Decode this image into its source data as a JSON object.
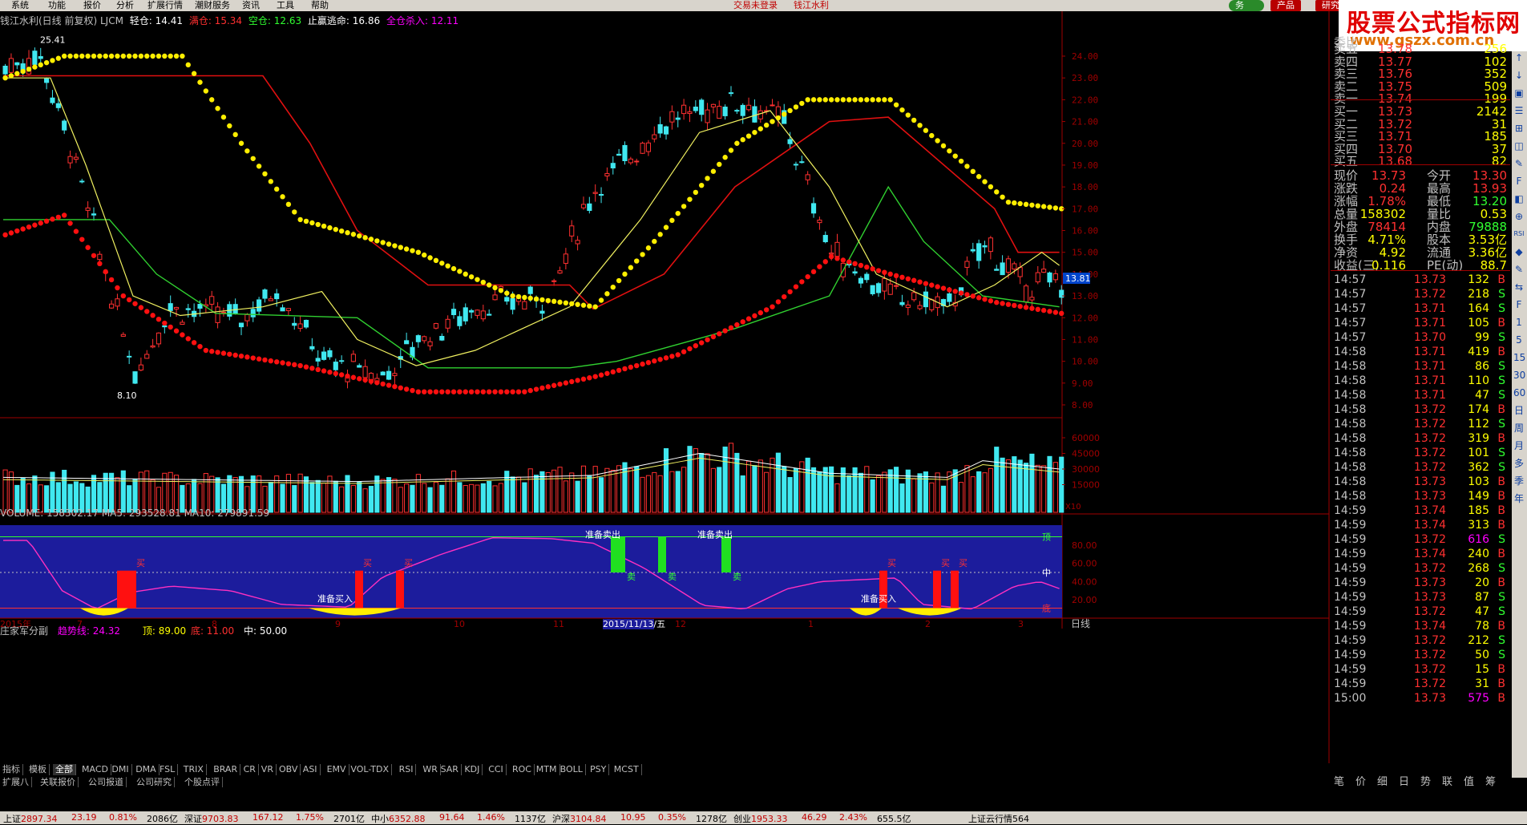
{
  "menu": [
    "系统",
    "功能",
    "报价",
    "分析",
    "扩展行情",
    "潮财服务",
    "资讯",
    "工具",
    "帮助"
  ],
  "menu_center": [
    "交易未登录",
    "钱江水利"
  ],
  "top_buttons": [
    "务",
    "产品",
    "研究"
  ],
  "logo": {
    "line1": "股票公式指标网",
    "line2": "www.gszx.com.cn"
  },
  "main_indicator": {
    "name": "钱江水利(日线 前复权) LJCM",
    "items": [
      {
        "label": "轻仓: 14.41",
        "color": "#ffffff"
      },
      {
        "label": "满仓: 15.34",
        "color": "#ff3030"
      },
      {
        "label": "空仓: 12.63",
        "color": "#30ff30"
      },
      {
        "label": "止赢逃命: 16.86",
        "color": "#ffffff"
      },
      {
        "label": "全仓杀入: 12.11",
        "color": "#ff00ff"
      }
    ],
    "high_label": "25.41",
    "low_label": "8.10",
    "current_price_tag": "13.81",
    "y_ticks": [
      "24.00",
      "23.00",
      "22.00",
      "21.00",
      "20.00",
      "19.00",
      "18.00",
      "17.00",
      "16.00",
      "15.00",
      "14.00",
      "13.00",
      "12.00",
      "11.00",
      "10.00",
      "9.00",
      "8.00"
    ]
  },
  "volume_indicator": {
    "title": "VOLUME: 158302.17  MA5: 293528.81  MA10: 279891.59",
    "y_ticks": [
      "60000",
      "45000",
      "30000",
      "15000"
    ],
    "unit": "X10"
  },
  "sub_indicator": {
    "name": "庄家军分副",
    "trend": "趋势线: 24.32",
    "top": "顶: 89.00",
    "bottom": "底: 11.00",
    "mid": "中: 50.00",
    "y_ticks": [
      "80.00",
      "60.00",
      "40.00",
      "20.00"
    ],
    "labels_right": [
      "顶",
      "中",
      "底"
    ],
    "signal_ready_sell": "准备卖出",
    "signal_ready_buy": "准备买入",
    "signal_buy": "买",
    "signal_sell": "卖"
  },
  "x_axis": {
    "labels": [
      "2015年",
      "7",
      "8",
      "9",
      "10",
      "11",
      "2015/11/13/五",
      "12",
      "1",
      "2",
      "3"
    ],
    "period": "日线"
  },
  "quote": {
    "header": "委比",
    "sell": [
      {
        "label": "卖五",
        "price": "13.78",
        "vol": "256"
      },
      {
        "label": "卖四",
        "price": "13.77",
        "vol": "102"
      },
      {
        "label": "卖三",
        "price": "13.76",
        "vol": "352"
      },
      {
        "label": "卖二",
        "price": "13.75",
        "vol": "509"
      },
      {
        "label": "卖一",
        "price": "13.74",
        "vol": "199"
      }
    ],
    "buy": [
      {
        "label": "买一",
        "price": "13.73",
        "vol": "2142"
      },
      {
        "label": "买二",
        "price": "13.72",
        "vol": "31"
      },
      {
        "label": "买三",
        "price": "13.71",
        "vol": "185"
      },
      {
        "label": "买四",
        "price": "13.70",
        "vol": "37"
      },
      {
        "label": "买五",
        "price": "13.68",
        "vol": "82"
      }
    ],
    "stats": [
      {
        "l1": "现价",
        "v1": "13.73",
        "c1": "#ff3030",
        "l2": "今开",
        "v2": "13.30",
        "c2": "#ff3030"
      },
      {
        "l1": "涨跌",
        "v1": "0.24",
        "c1": "#ff3030",
        "l2": "最高",
        "v2": "13.93",
        "c2": "#ff3030"
      },
      {
        "l1": "涨幅",
        "v1": "1.78%",
        "c1": "#ff3030",
        "l2": "最低",
        "v2": "13.20",
        "c2": "#30ff30"
      },
      {
        "l1": "总量",
        "v1": "158302",
        "c1": "#ffff00",
        "l2": "量比",
        "v2": "0.53",
        "c2": "#ffff00"
      },
      {
        "l1": "外盘",
        "v1": "78414",
        "c1": "#ff3030",
        "l2": "内盘",
        "v2": "79888",
        "c2": "#30ff30"
      },
      {
        "l1": "换手",
        "v1": "4.71%",
        "c1": "#ffff00",
        "l2": "股本",
        "v2": "3.53亿",
        "c2": "#ffff00"
      },
      {
        "l1": "净资",
        "v1": "4.92",
        "c1": "#ffff00",
        "l2": "流通",
        "v2": "3.36亿",
        "c2": "#ffff00"
      },
      {
        "l1": "收益(三)",
        "v1": "0.116",
        "c1": "#ffff00",
        "l2": "PE(动)",
        "v2": "88.7",
        "c2": "#ffff00"
      }
    ],
    "ticks": [
      [
        "14:57",
        "13.73",
        "132",
        "B"
      ],
      [
        "14:57",
        "13.72",
        "218",
        "S"
      ],
      [
        "14:57",
        "13.71",
        "164",
        "S"
      ],
      [
        "14:57",
        "13.71",
        "105",
        "B"
      ],
      [
        "14:57",
        "13.70",
        "99",
        "S"
      ],
      [
        "14:58",
        "13.71",
        "419",
        "B"
      ],
      [
        "14:58",
        "13.71",
        "86",
        "S"
      ],
      [
        "14:58",
        "13.71",
        "110",
        "S"
      ],
      [
        "14:58",
        "13.71",
        "47",
        "S"
      ],
      [
        "14:58",
        "13.72",
        "174",
        "B"
      ],
      [
        "14:58",
        "13.72",
        "112",
        "S"
      ],
      [
        "14:58",
        "13.72",
        "319",
        "B"
      ],
      [
        "14:58",
        "13.72",
        "101",
        "S"
      ],
      [
        "14:58",
        "13.72",
        "362",
        "S"
      ],
      [
        "14:58",
        "13.73",
        "103",
        "B"
      ],
      [
        "14:58",
        "13.73",
        "149",
        "B"
      ],
      [
        "14:59",
        "13.74",
        "185",
        "B"
      ],
      [
        "14:59",
        "13.74",
        "313",
        "B"
      ],
      [
        "14:59",
        "13.72",
        "616",
        "S"
      ],
      [
        "14:59",
        "13.74",
        "240",
        "B"
      ],
      [
        "14:59",
        "13.72",
        "268",
        "S"
      ],
      [
        "14:59",
        "13.73",
        "20",
        "B"
      ],
      [
        "14:59",
        "13.73",
        "87",
        "S"
      ],
      [
        "14:59",
        "13.72",
        "47",
        "S"
      ],
      [
        "14:59",
        "13.74",
        "78",
        "B"
      ],
      [
        "14:59",
        "13.72",
        "212",
        "S"
      ],
      [
        "14:59",
        "13.72",
        "50",
        "S"
      ],
      [
        "14:59",
        "13.72",
        "15",
        "B"
      ],
      [
        "14:59",
        "13.72",
        "31",
        "B"
      ],
      [
        "15:00",
        "13.73",
        "575",
        "B"
      ]
    ]
  },
  "right_tabs": [
    "笔",
    "价",
    "细",
    "日",
    "势",
    "联",
    "值",
    "筹"
  ],
  "tabs_row1": [
    "指标",
    "模板",
    "全部",
    "MACD",
    "DMI",
    "DMA",
    "FSL",
    "TRIX",
    "BRAR",
    "CR",
    "VR",
    "OBV",
    "ASI",
    "EMV",
    "VOL-TDX",
    "RSI",
    "WR",
    "SAR",
    "KDJ",
    "CCI",
    "ROC",
    "MTM",
    "BOLL",
    "PSY",
    "MCST"
  ],
  "tabs_row2": [
    "扩展八",
    "关联报价",
    "公司报道",
    "公司研究",
    "个股点评"
  ],
  "status": [
    {
      "t": "上证",
      "v": "2897.34",
      "c": "#c00000"
    },
    {
      "t": "",
      "v": "23.19",
      "c": "#c00000"
    },
    {
      "t": "",
      "v": "0.81%",
      "c": "#c00000"
    },
    {
      "t": "",
      "v": "2086亿",
      "c": "#000"
    },
    {
      "t": "深证",
      "v": "9703.83",
      "c": "#c00000"
    },
    {
      "t": "",
      "v": "167.12",
      "c": "#c00000"
    },
    {
      "t": "",
      "v": "1.75%",
      "c": "#c00000"
    },
    {
      "t": "",
      "v": "2701亿",
      "c": "#000"
    },
    {
      "t": "中小",
      "v": "6352.88",
      "c": "#c00000"
    },
    {
      "t": "",
      "v": "91.64",
      "c": "#c00000"
    },
    {
      "t": "",
      "v": "1.46%",
      "c": "#c00000"
    },
    {
      "t": "",
      "v": "1137亿",
      "c": "#000"
    },
    {
      "t": "沪深",
      "v": "3104.84",
      "c": "#c00000"
    },
    {
      "t": "",
      "v": "10.95",
      "c": "#c00000"
    },
    {
      "t": "",
      "v": "0.35%",
      "c": "#c00000"
    },
    {
      "t": "",
      "v": "1278亿",
      "c": "#000"
    },
    {
      "t": "创业",
      "v": "1953.33",
      "c": "#c00000"
    },
    {
      "t": "",
      "v": "46.29",
      "c": "#c00000"
    },
    {
      "t": "",
      "v": "2.43%",
      "c": "#c00000"
    },
    {
      "t": "",
      "v": "655.5亿",
      "c": "#000"
    },
    {
      "t": "",
      "v": "上证云行情564",
      "c": "#000"
    }
  ]
}
